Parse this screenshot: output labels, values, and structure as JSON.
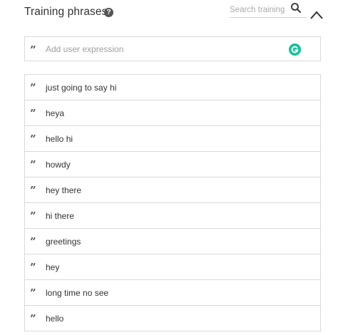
{
  "header": {
    "title": "Training phrases",
    "help_icon": "question-circle-icon",
    "help_glyph": "?",
    "search_placeholder": "Search training phrases",
    "search_icon": "search-icon",
    "collapse_icon": "chevron-up-icon"
  },
  "add_row": {
    "quote_icon": "quote-icon",
    "placeholder": "Add user expression",
    "grammarly_icon": "grammarly-icon",
    "grammarly_color": "#15c39a"
  },
  "phrases": [
    "just going to say hi",
    "heya",
    "hello hi",
    "howdy",
    "hey there",
    "hi there",
    "greetings",
    "hey",
    "long time no see",
    "hello"
  ]
}
